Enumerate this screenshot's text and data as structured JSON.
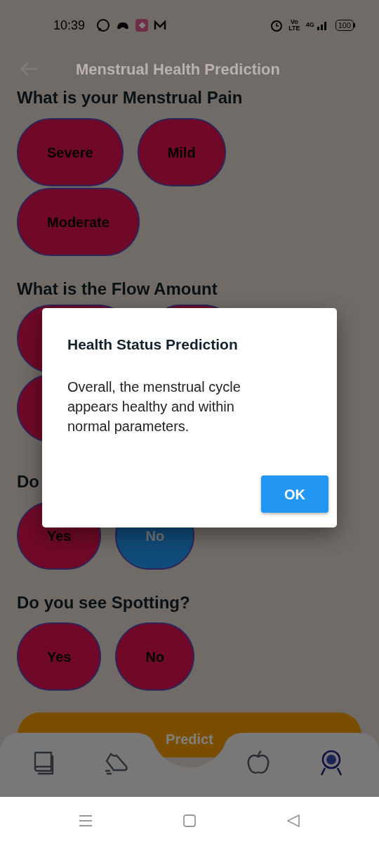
{
  "status_bar": {
    "time": "10:39",
    "volte_top": "Vo",
    "volte_bottom": "LTE",
    "network": "4G",
    "battery": "100"
  },
  "app_bar": {
    "title": "Menstrual Health Prediction"
  },
  "questions": [
    {
      "question": "What is your Menstrual Pain",
      "options": [
        {
          "kind": "option",
          "label": "Severe",
          "selected": false
        },
        {
          "kind": "option",
          "label": "Mild",
          "selected": false
        },
        {
          "kind": "option",
          "label": "Moderate",
          "selected": false
        }
      ]
    },
    {
      "question": "What is the Flow Amount",
      "options": [
        {
          "kind": "covered"
        },
        {
          "kind": "covered"
        },
        {
          "kind": "covered"
        }
      ]
    },
    {
      "question": "Do",
      "options": [
        {
          "kind": "option",
          "label": "Yes",
          "selected": false
        },
        {
          "kind": "option",
          "label": "No",
          "selected": true
        }
      ]
    },
    {
      "question": "Do you see Spotting?",
      "options": [
        {
          "kind": "option",
          "label": "Yes",
          "selected": false
        },
        {
          "kind": "option",
          "label": "No",
          "selected": false
        }
      ]
    }
  ],
  "predict_button": {
    "label": "Predict"
  },
  "bottom_nav": [
    {
      "selected": false
    },
    {
      "selected": false
    },
    {
      "selected": false
    },
    {
      "selected": true
    }
  ],
  "dialog": {
    "title": "Health Status Prediction",
    "message": "Overall, the menstrual cycle appears healthy and within normal parameters.",
    "button": "OK"
  }
}
